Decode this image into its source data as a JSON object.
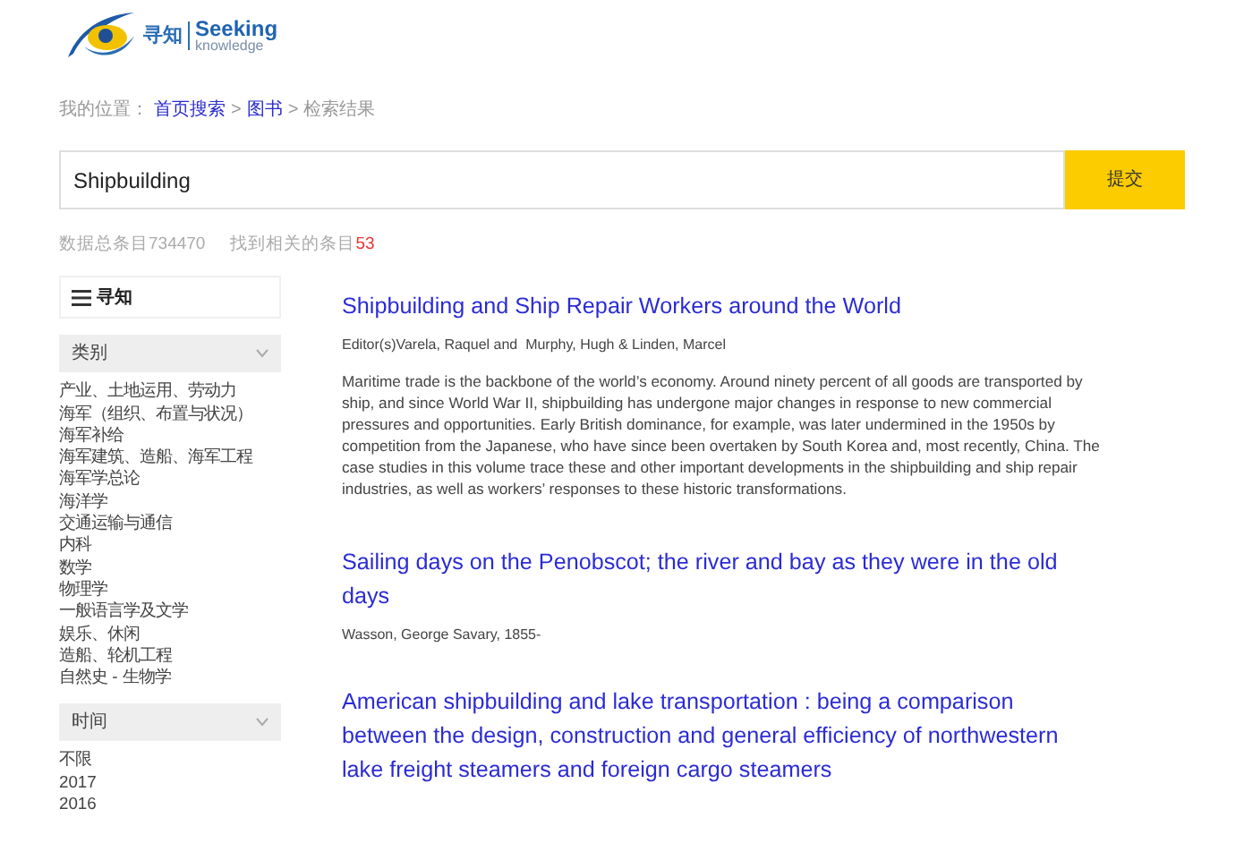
{
  "logo": {
    "cn": "寻知",
    "en": "Seeking",
    "sub": "knowledge"
  },
  "breadcrumb": {
    "prefix": "我的位置：",
    "items": [
      {
        "label": "首页搜索",
        "link": true
      },
      {
        "label": "图书",
        "link": true
      },
      {
        "label": "检索结果",
        "link": false
      }
    ],
    "separator": ">"
  },
  "search": {
    "value": "Shipbuilding",
    "button": "提交"
  },
  "stats": {
    "total_label": "数据总条目",
    "total": "734470",
    "found_label": "找到相关的条目",
    "found": "53"
  },
  "sidebar": {
    "title": "寻知",
    "sections": [
      {
        "heading": "类别",
        "items": [
          "产业、土地运用、劳动力",
          "海军（组织、布置与状况）",
          "海军补给",
          "海军建筑、造船、海军工程",
          "海军学总论",
          "海洋学",
          "交通运输与通信",
          "内科",
          "数学",
          "物理学",
          "一般语言学及文学",
          "娱乐、休闲",
          "造船、轮机工程",
          "自然史 - 生物学"
        ]
      },
      {
        "heading": "时间",
        "items": [
          "不限",
          "2017",
          "2016"
        ]
      }
    ]
  },
  "results": [
    {
      "title": "Shipbuilding and Ship Repair Workers around the World",
      "authors": "Editor(s)Varela, Raquel and  Murphy, Hugh & Linden, Marcel",
      "abstract": "Maritime trade is the backbone of the world’s economy. Around ninety percent of all goods are transported by ship, and since World War II, shipbuilding has undergone major changes in response to new commercial pressures and opportunities. Early British dominance, for example, was later undermined in the 1950s by competition from the Japanese, who have since been overtaken by South Korea and, most recently, China. The case studies in this volume trace these and other important developments in the shipbuilding and ship repair industries, as well as workers’ responses to these historic transformations."
    },
    {
      "title": "Sailing days on the Penobscot; the river and bay as they were in the old days",
      "authors": "Wasson, George Savary, 1855-"
    },
    {
      "title": "American shipbuilding and lake transportation : being a comparison between the design, construction and general efficiency of northwestern lake freight steamers and foreign cargo steamers"
    }
  ]
}
